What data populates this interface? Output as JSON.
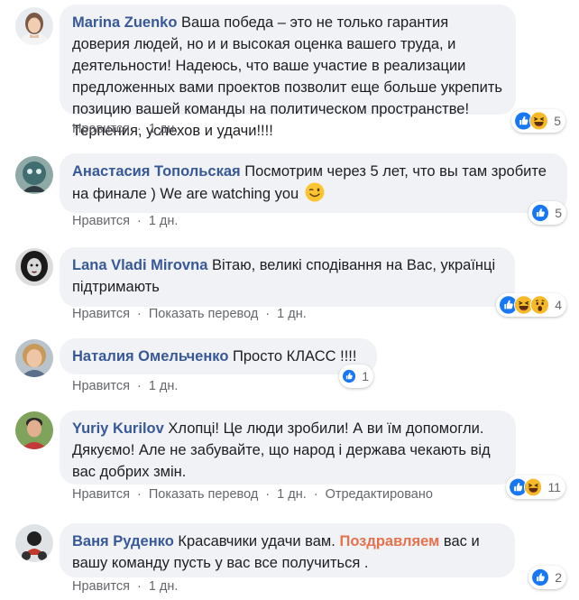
{
  "actions": {
    "like": "Нравится",
    "translate": "Показать перевод",
    "edited": "Отредактировано",
    "separator": "·"
  },
  "comments": [
    {
      "author": "Marina Zuenko",
      "text": "Ваша победа – это не только гарантия доверия людей, но и и высокая оценка вашего труда, и деятельности! Надеюсь, что ваше участие в реализации предложенных вами проектов позволит еще больше укрепить позицию вашей команды на политическом пространстве! Терпения, успехов и удачи!!!!",
      "time": "1 дн.",
      "reaction_count": "5",
      "reactions": [
        "like",
        "haha"
      ]
    },
    {
      "author": "Анастасия Топольская",
      "text": "Посмотрим через 5 лет, что вы там зробите на финале ) We are watching you",
      "emoji": "wink-emoji",
      "time": "1 дн.",
      "reaction_count": "5",
      "reactions": [
        "like"
      ]
    },
    {
      "author": "Lana Vladi Mirovna",
      "text": "Вітаю, великі сподівання на Вас, українці підтримають",
      "time": "1 дн.",
      "reaction_count": "4",
      "reactions": [
        "like",
        "haha",
        "wow"
      ]
    },
    {
      "author": "Наталия Омельченко",
      "text": "Просто КЛАСС !!!!",
      "time": "1 дн.",
      "reaction_count": "1",
      "reactions": [
        "like"
      ]
    },
    {
      "author": "Yuriy Kurilov",
      "text": "Хлопці! Це люди зробили! А ви їм допомогли. Дякуємо! Але не забувайте, що народ і держава чекають від вас добрих змін.",
      "time": "1 дн.",
      "reaction_count": "11",
      "reactions": [
        "like",
        "haha"
      ]
    },
    {
      "author": "Ваня Руденко",
      "text_before": "Красавчики удачи вам.",
      "highlight": "Поздравляем",
      "text_after": "вас и вашу команду пусть у вас все получиться .",
      "time": "1 дн.",
      "reaction_count": "2",
      "reactions": [
        "like"
      ]
    }
  ],
  "colors": {
    "author": "#385898",
    "bubble": "#f0f2f5",
    "muted": "#65676b",
    "like": "#1877f2",
    "haha": "#f7b928",
    "highlight": "#e4724d"
  }
}
